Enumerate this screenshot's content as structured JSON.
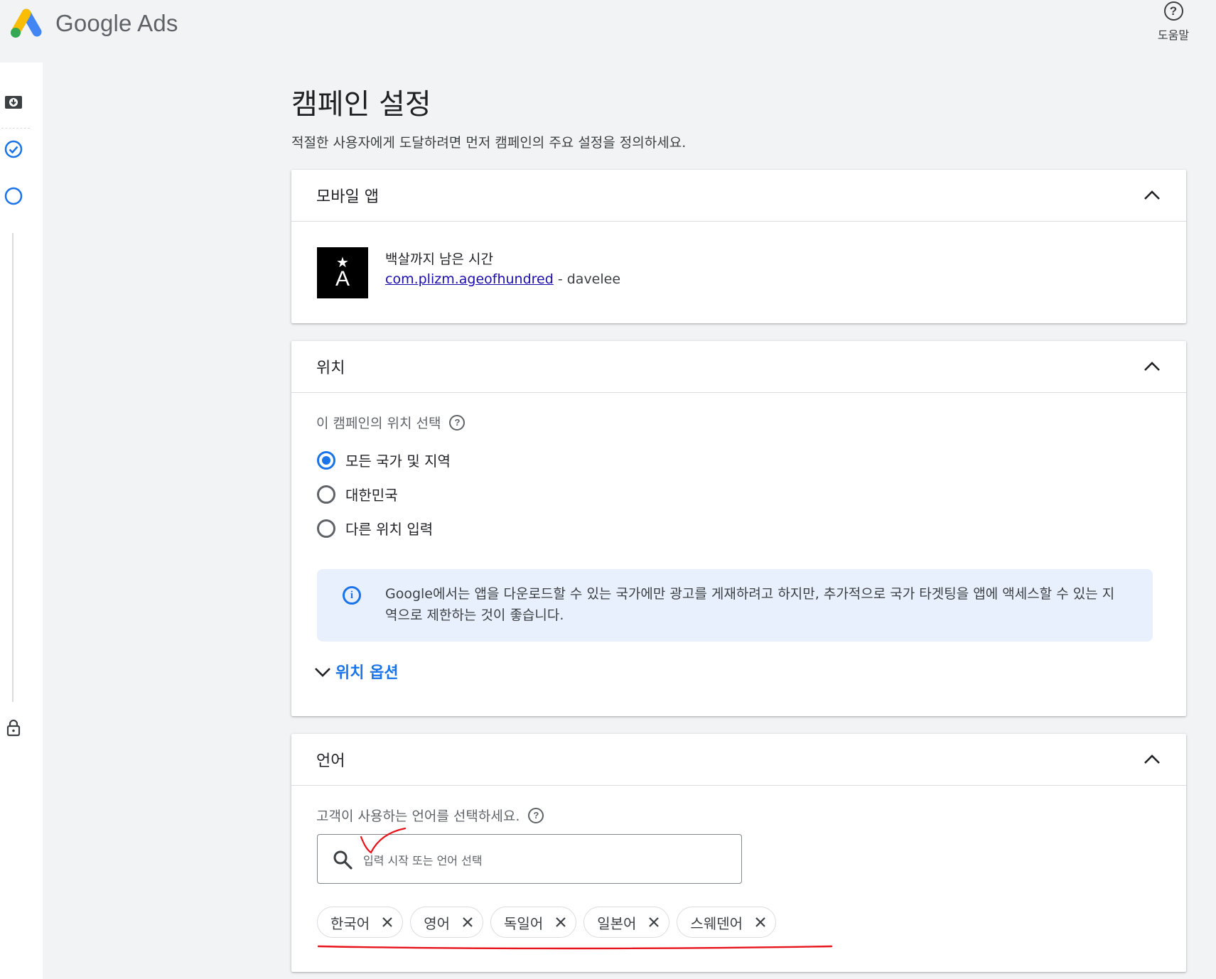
{
  "header": {
    "brand": "Google Ads",
    "help_label": "도움말",
    "help_glyph": "?"
  },
  "rail": {
    "icons": [
      "download-icon",
      "check-circle-icon",
      "empty-circle-icon",
      "lock-icon"
    ]
  },
  "page": {
    "title": "캠페인 설정",
    "subtitle": "적절한 사용자에게 도달하려면 먼저 캠페인의 주요 설정을 정의하세요."
  },
  "app_card": {
    "title": "모바일 앱",
    "app_name": "백살까지 남은 시간",
    "package": "com.plizm.ageofhundred",
    "separator": " - ",
    "developer": "davelee",
    "icon_letter": "A",
    "icon_star": "★"
  },
  "location_card": {
    "title": "위치",
    "question": "이 캠페인의 위치 선택",
    "options": [
      {
        "label": "모든 국가 및 지역",
        "selected": true
      },
      {
        "label": "대한민국",
        "selected": false
      },
      {
        "label": "다른 위치 입력",
        "selected": false
      }
    ],
    "info_glyph": "i",
    "info_text": "Google에서는 앱을 다운로드할 수 있는 국가에만 광고를 게재하려고 하지만, 추가적으로 국가 타겟팅을 앱에 액세스할 수 있는 지역으로 제한하는 것이 좋습니다.",
    "options_toggle": "위치 옵션"
  },
  "language_card": {
    "title": "언어",
    "question": "고객이 사용하는 언어를 선택하세요.",
    "search_placeholder": "입력 시작 또는 언어 선택",
    "chips": [
      "한국어",
      "영어",
      "독일어",
      "일본어",
      "스웨덴어"
    ]
  },
  "colors": {
    "accent": "#1a73e8",
    "annotation": "#e8141b",
    "background": "#f1f3f4"
  }
}
